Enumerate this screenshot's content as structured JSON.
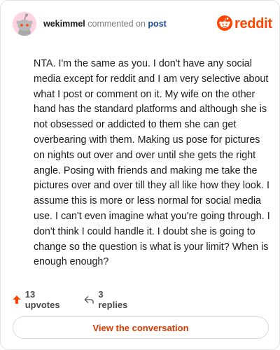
{
  "header": {
    "username": "wekimmel",
    "action_text": "commented on",
    "target_link": "post",
    "brand_name": "reddit"
  },
  "comment": {
    "body": "NTA. I'm the same as you. I don't have any social media except for reddit and I am very selective about what I post or comment on it. My wife on the other hand has the standard platforms and although she is not obsessed or addicted to them she can get overbearing with them. Making us pose for pictures on nights out over and over until she gets the right angle. Posing with friends and making me take the pictures over and over till they all like how they look. I assume this is more or less normal for social media use. I can't even imagine what you're going through. I don't think I could handle it. I doubt she is going to change so the question is what is your limit? When is enough enough?"
  },
  "actions": {
    "upvotes": "13 upvotes",
    "replies": "3 replies",
    "upvote_icon": "upvote-arrow-icon",
    "reply_icon": "reply-arrow-icon"
  },
  "footer": {
    "button_label": "View the conversation"
  },
  "colors": {
    "brand": "#ff4500",
    "link": "#1a4b8c",
    "avatar_bg": "#ffd2e1"
  }
}
